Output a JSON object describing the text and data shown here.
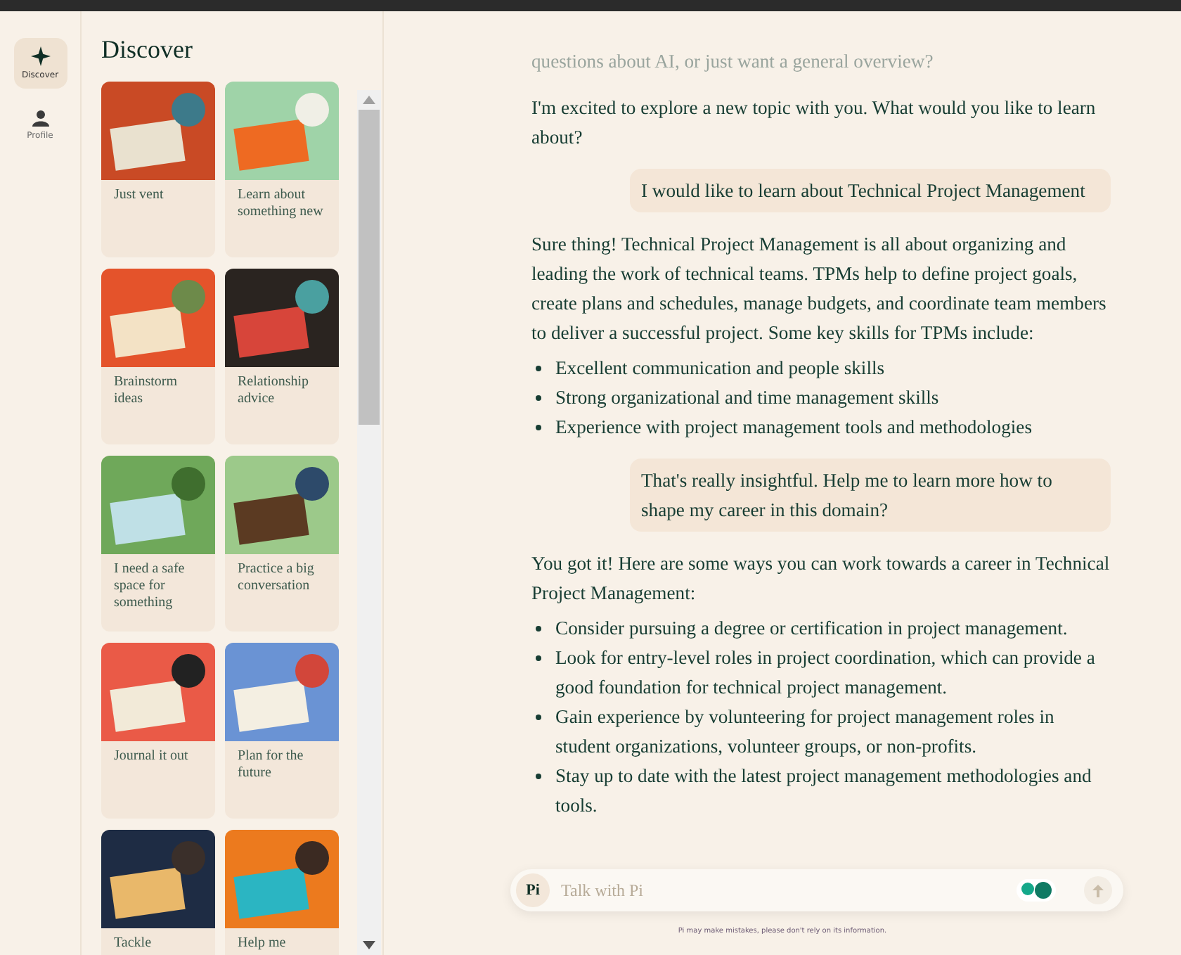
{
  "nav": [
    {
      "label": "Discover",
      "selected": true
    },
    {
      "label": "Profile",
      "selected": false
    }
  ],
  "discover": {
    "title": "Discover",
    "cards": [
      {
        "label": "Just vent"
      },
      {
        "label": "Learn about something new"
      },
      {
        "label": "Brainstorm ideas"
      },
      {
        "label": "Relationship advice"
      },
      {
        "label": "I need a safe space for something"
      },
      {
        "label": "Practice a big conversation"
      },
      {
        "label": "Journal it out"
      },
      {
        "label": "Plan for the future"
      },
      {
        "label": "Tackle"
      },
      {
        "label": "Help me"
      }
    ]
  },
  "chat": {
    "messages": [
      {
        "kind": "ai",
        "paragraphs": [
          "questions about AI, or just want a general overview?"
        ],
        "faded": true
      },
      {
        "kind": "ai",
        "paragraphs": [
          "I'm excited to explore a new topic with you. What would you like to learn about?"
        ],
        "faded": false
      },
      {
        "kind": "user",
        "paragraphs": [
          "I would like to learn about Technical Project Management"
        ]
      },
      {
        "kind": "ai",
        "paragraphs": [
          "Sure thing! Technical Project Management is all about organizing and leading the work of technical teams. TPMs help to define project goals, create plans and schedules, manage budgets, and coordinate team members to deliver a successful project. Some key skills for TPMs include:"
        ],
        "bullets": [
          "Excellent communication and people skills",
          "Strong organizational and time management skills",
          "Experience with project management tools and methodologies"
        ],
        "faded": false
      },
      {
        "kind": "user",
        "paragraphs": [
          "That's really insightful. Help me to learn more how to shape my career in this domain?"
        ]
      },
      {
        "kind": "ai",
        "paragraphs": [
          "You got it! Here are some ways you can work towards a career in Technical Project Management:"
        ],
        "bullets": [
          "Consider pursuing a degree or certification in project management.",
          "Look for entry-level roles in project coordination, which can provide a good foundation for technical project management.",
          "Gain experience by volunteering for project management roles in student organizations, volunteer groups, or non-profits.",
          "Stay up to date with the latest project management methodologies and tools."
        ],
        "faded": false
      }
    ],
    "composer": {
      "badge": "Pi",
      "placeholder": "Talk with Pi"
    },
    "disclaimer": "Pi may make mistakes, please don't rely on its information."
  }
}
